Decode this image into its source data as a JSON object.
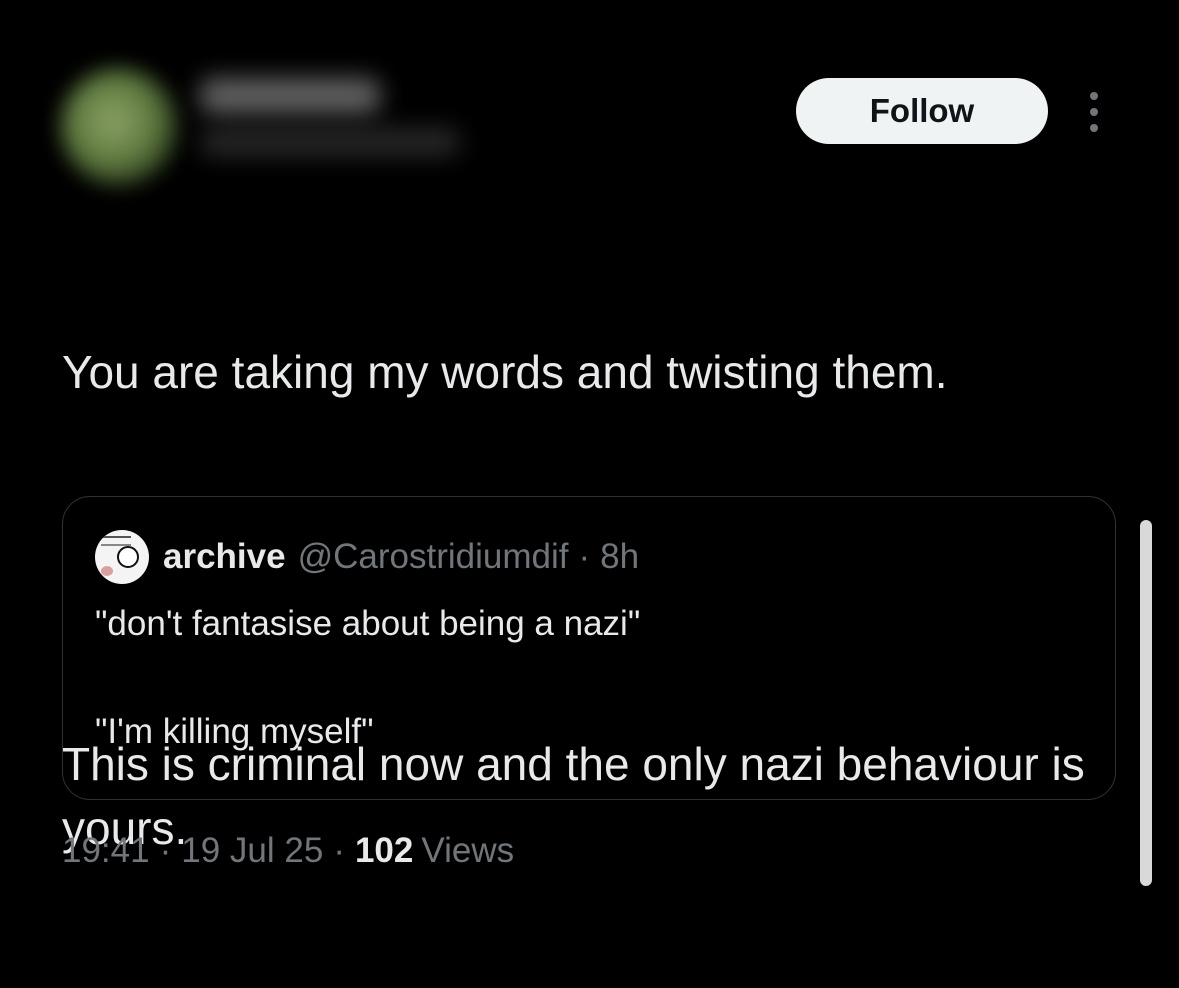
{
  "header": {
    "follow_label": "Follow",
    "more_icon": "more-vertical-icon"
  },
  "tweet": {
    "paragraphs": [
      "You are taking my words and twisting them.",
      "This is criminal now and the only nazi behaviour is yours."
    ]
  },
  "quote": {
    "display_name": "archive",
    "handle": "@Carostridiumdif",
    "separator": "·",
    "time": "8h",
    "paragraphs": [
      "\"don't fantasise about being a nazi\"",
      "\"I'm killing myself\""
    ]
  },
  "meta": {
    "time": "19:41",
    "separator": "·",
    "date": "19 Jul 25",
    "views_count": "102",
    "views_label": "Views"
  },
  "colors": {
    "background": "#000000",
    "text_primary": "#e7e9ea",
    "text_secondary": "#71767b",
    "follow_button_bg": "#eff3f4",
    "border": "#2f3336"
  }
}
